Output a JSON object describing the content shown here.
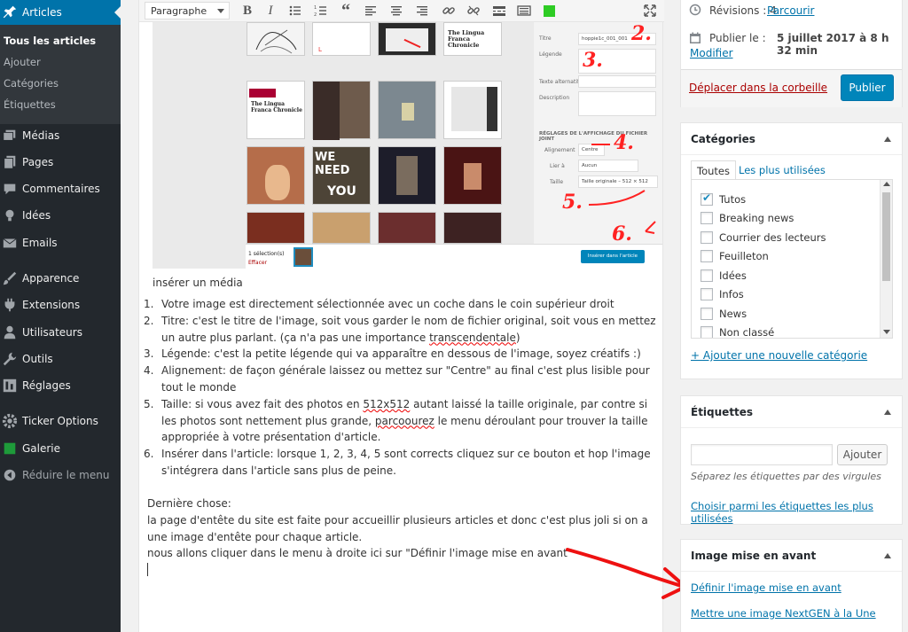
{
  "sidebar": {
    "items": [
      {
        "label": "Articles",
        "icon": "pin-icon",
        "current": true
      },
      {
        "label": "Médias",
        "icon": "media-icon"
      },
      {
        "label": "Pages",
        "icon": "pages-icon"
      },
      {
        "label": "Commentaires",
        "icon": "comments-icon"
      },
      {
        "label": "Idées",
        "icon": "lightbulb-icon"
      },
      {
        "label": "Emails",
        "icon": "email-icon"
      },
      {
        "label": "Apparence",
        "icon": "brush-icon"
      },
      {
        "label": "Extensions",
        "icon": "plugin-icon"
      },
      {
        "label": "Utilisateurs",
        "icon": "users-icon"
      },
      {
        "label": "Outils",
        "icon": "tools-icon"
      },
      {
        "label": "Réglages",
        "icon": "settings-icon"
      },
      {
        "label": "Ticker Options",
        "icon": "gear-icon"
      },
      {
        "label": "Galerie",
        "icon": "gallery-icon"
      }
    ],
    "submenu": [
      "Tous les articles",
      "Ajouter",
      "Catégories",
      "Étiquettes"
    ],
    "collapse_label": "Réduire le menu"
  },
  "toolbar": {
    "format_value": "Paragraphe",
    "buttons": [
      "bold-icon",
      "italic-icon",
      "bullet-list-icon",
      "numbered-list-icon",
      "quote-icon",
      "align-left-icon",
      "align-center-icon",
      "align-right-icon",
      "link-icon",
      "unlink-icon",
      "read-more-icon",
      "toolbar-toggle-icon",
      "green-square-icon",
      "fullscreen-icon"
    ]
  },
  "media_screenshot": {
    "fields": {
      "title_label": "Titre",
      "title_value": "hoppie1c_001_001",
      "caption_label": "Légende",
      "alt_label": "Texte alternatif",
      "desc_label": "Description",
      "section_title": "RÉGLAGES DE L'AFFICHAGE DU FICHIER JOINT",
      "align_label": "Alignement",
      "align_value": "Centre",
      "link_label": "Lier à",
      "link_value": "Aucun",
      "size_label": "Taille",
      "size_value": "Taille originale – 512 × 512"
    },
    "selection_count": "1 sélection(s)",
    "clear_label": "Effacer",
    "insert_label": "Insérer dans l'article",
    "thumb_texts": {
      "newspaper": "The Lingua Franca Chronicle",
      "we_need": "WE NEED",
      "you": "YOU"
    },
    "annotations": [
      "2.",
      "3.",
      "4.",
      "5.",
      "6."
    ]
  },
  "content": {
    "caption": "insérer un média",
    "steps": [
      {
        "n": "1.",
        "text": "Votre image est directement sélectionnée avec un coche dans le coin supérieur droit"
      },
      {
        "n": "2.",
        "pre": "Titre: c'est le titre de l'image, soit vous garder le nom de fichier original, soit vous en mettez un autre plus parlant. (ça n'a pas une importance ",
        "underlined": "transcendentale",
        "post": ")"
      },
      {
        "n": "3.",
        "text": "Légende: c'est la petite légende qui va apparaître en dessous de l'image, soyez créatifs :)"
      },
      {
        "n": "4.",
        "text": "Alignement: de façon générale laissez ou mettez sur \"Centre\" au final c'est plus lisible pour tout le monde"
      },
      {
        "n": "5.",
        "pre": "Taille: si vous avez fait des photos en ",
        "underlined": "512x512",
        "mid": " autant laissé la taille originale, par contre si les photos sont nettement plus grande, ",
        "underlined2": "parcoourez",
        "post": " le menu déroulant pour trouver la taille appropriée à votre présentation d'article."
      },
      {
        "n": "6.",
        "text": "Insérer dans l'article: lorsque 1, 2, 3, 4, 5 sont corrects cliquez sur ce bouton et hop l'image s'intégrera dans l'article sans plus de peine."
      }
    ],
    "last_heading": "Dernière chose:",
    "last_para": "la page d'entête du site est faite pour accueillir plusieurs articles et donc c'est plus joli si on a une image d'entête pour chaque article.",
    "last_line": "nous allons cliquer dans le menu à droite ici sur \"Définir l'image mise en avant\""
  },
  "publish": {
    "revisions_label": "Révisions : 4",
    "revisions_link": "Parcourir",
    "schedule_label": "Publier le :",
    "schedule_value": "5 juillet 2017 à 8 h 32 min",
    "modify_link": "Modifier",
    "trash_link": "Déplacer dans la corbeille",
    "publish_button": "Publier"
  },
  "categories": {
    "title": "Catégories",
    "tabs": [
      "Toutes",
      "Les plus utilisées"
    ],
    "items": [
      {
        "label": "Tutos",
        "checked": true
      },
      {
        "label": "Breaking news",
        "checked": false
      },
      {
        "label": "Courrier des lecteurs",
        "checked": false
      },
      {
        "label": "Feuilleton",
        "checked": false
      },
      {
        "label": "Idées",
        "checked": false
      },
      {
        "label": "Infos",
        "checked": false
      },
      {
        "label": "News",
        "checked": false
      },
      {
        "label": "Non classé",
        "checked": false
      }
    ],
    "add_link": "+ Ajouter une nouvelle catégorie"
  },
  "tags": {
    "title": "Étiquettes",
    "input_value": "",
    "add_button": "Ajouter",
    "hint": "Séparez les étiquettes par des virgules",
    "popular_link": "Choisir parmi les étiquettes les plus utilisées"
  },
  "featured": {
    "title": "Image mise en avant",
    "set_link": "Définir l'image mise en avant",
    "nextgen_link": "Mettre une image NextGEN à la Une"
  },
  "colors": {
    "sidebar_bg": "#23282d",
    "accent": "#0073aa",
    "annotation_red": "#ff2222"
  }
}
